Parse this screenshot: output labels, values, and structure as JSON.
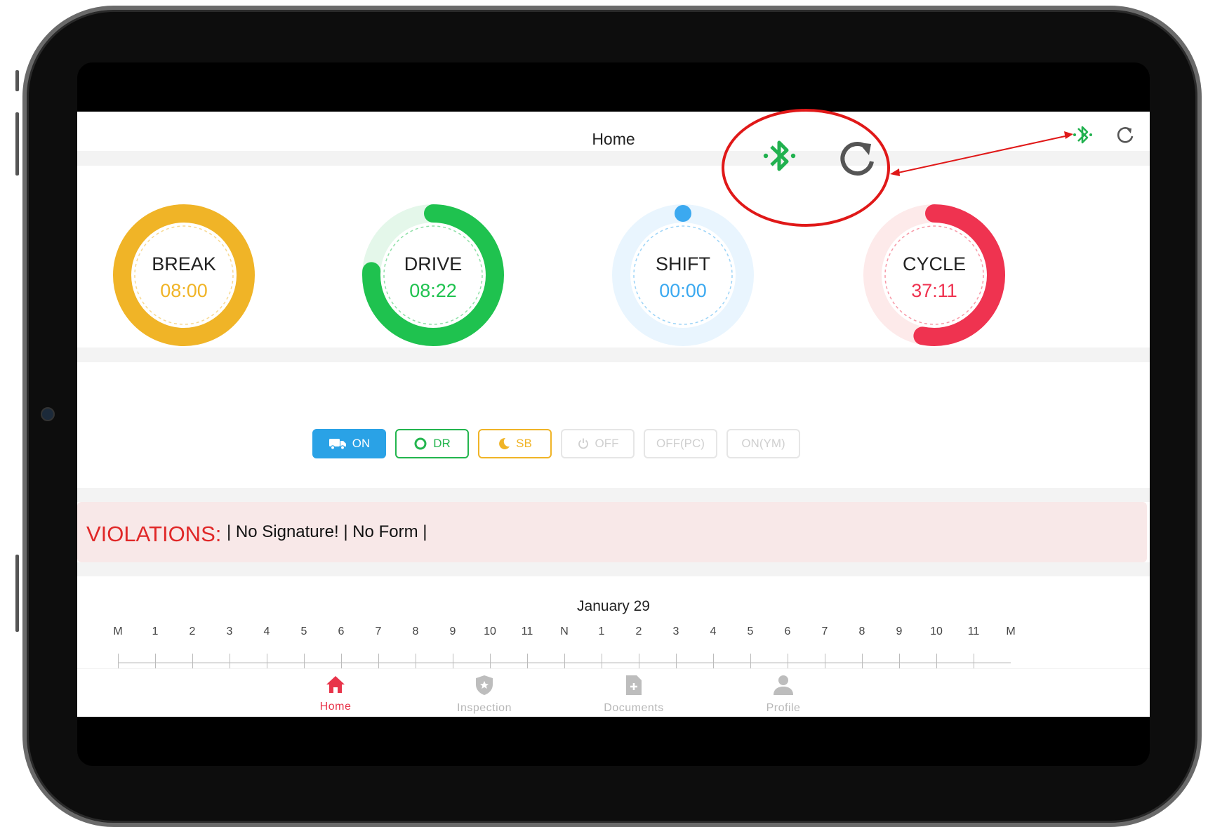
{
  "header": {
    "title": "Home"
  },
  "gauges": [
    {
      "label": "BREAK",
      "value": "08:00",
      "color": "#f0b427",
      "progress": 1.0
    },
    {
      "label": "DRIVE",
      "value": "08:22",
      "color": "#1fc24f",
      "progress": 0.76
    },
    {
      "label": "SHIFT",
      "value": "00:00",
      "color": "#3ba9f0",
      "progress": 0.0
    },
    {
      "label": "CYCLE",
      "value": "37:11",
      "color": "#ef3350",
      "progress": 0.53
    }
  ],
  "status_buttons": [
    {
      "label": "ON",
      "icon": "truck-icon",
      "state": "active"
    },
    {
      "label": "DR",
      "icon": "circle-icon",
      "state": "enabled"
    },
    {
      "label": "SB",
      "icon": "moon-icon",
      "state": "enabled"
    },
    {
      "label": "OFF",
      "icon": "power-icon",
      "state": "disabled"
    },
    {
      "label": "OFF(PC)",
      "icon": "",
      "state": "disabled"
    },
    {
      "label": "ON(YM)",
      "icon": "",
      "state": "disabled"
    }
  ],
  "violations": {
    "label": "VIOLATIONS:",
    "text": "| No Signature! | No Form |"
  },
  "timeline": {
    "date": "January 29",
    "hours": [
      "M",
      "1",
      "2",
      "3",
      "4",
      "5",
      "6",
      "7",
      "8",
      "9",
      "10",
      "11",
      "N",
      "1",
      "2",
      "3",
      "4",
      "5",
      "6",
      "7",
      "8",
      "9",
      "10",
      "11",
      "M"
    ]
  },
  "nav": [
    {
      "label": "Home",
      "icon": "home-icon",
      "active": true
    },
    {
      "label": "Inspection",
      "icon": "shield-star-icon",
      "active": false
    },
    {
      "label": "Documents",
      "icon": "document-plus-icon",
      "active": false
    },
    {
      "label": "Profile",
      "icon": "person-icon",
      "active": false
    }
  ],
  "colors": {
    "accent_active": "#e8344a",
    "on_button": "#2aa2e6",
    "bluetooth": "#21b14f",
    "annotation": "#e01818",
    "violation_bg": "#f8e8e8"
  }
}
